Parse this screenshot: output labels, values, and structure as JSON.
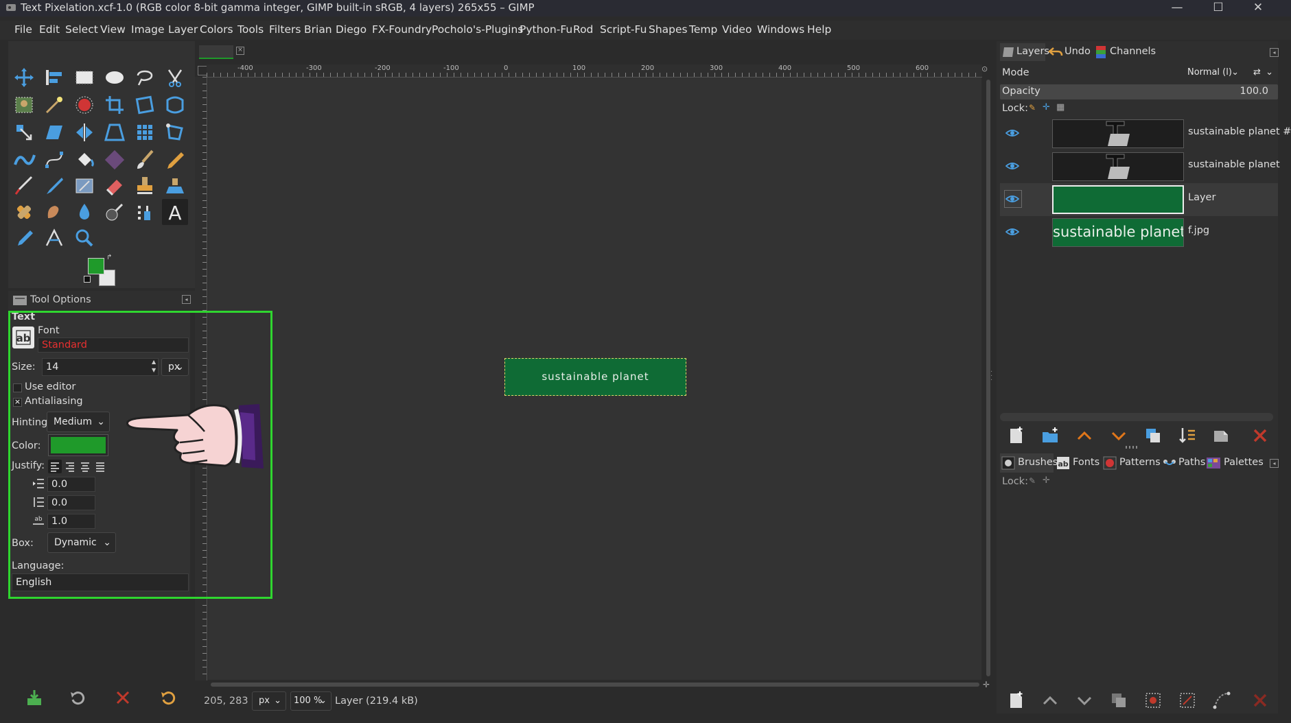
{
  "window": {
    "title": "Text Pixelation.xcf-1.0 (RGB color 8-bit gamma integer, GIMP built-in sRGB, 4 layers) 265x55 – GIMP",
    "minimize": "—",
    "maximize": "☐",
    "close": "✕"
  },
  "menu": [
    "File",
    "Edit",
    "Select",
    "View",
    "Image",
    "Layer",
    "Colors",
    "Tools",
    "Filters",
    "Brian",
    "Diego",
    "FX-Foundry",
    "Pocholo's-Plugins",
    "Python-Fu",
    "Rod",
    "Script-Fu",
    "Shapes",
    "Temp",
    "Video",
    "Windows",
    "Help"
  ],
  "toolbox": {
    "fg_color": "#1f9a2a",
    "bg_color": "#e8e8e8"
  },
  "tool_options": {
    "tab_label": "Tool Options",
    "tool_name": "Text",
    "font_label": "Font",
    "font_value": "Standard",
    "size_label": "Size:",
    "size_value": "14",
    "size_unit": "px",
    "use_editor_label": "Use editor",
    "antialiasing_label": "Antialiasing",
    "antialiasing_checked": "×",
    "hinting_label": "Hinting:",
    "hinting_value": "Medium",
    "color_label": "Color:",
    "color_value": "#1f9a2a",
    "justify_label": "Justify:",
    "indent_value": "0.0",
    "line_spacing_value": "0.0",
    "letter_spacing_value": "1.0",
    "box_label": "Box:",
    "box_value": "Dynamic",
    "language_label": "Language:",
    "language_value": "English"
  },
  "canvas": {
    "image_text": "sustainable planet",
    "image_color": "#0f6b35",
    "ruler_h_labels": [
      "-400",
      "-300",
      "-200",
      "-100",
      "0",
      "100",
      "200",
      "300",
      "400",
      "500",
      "600"
    ],
    "ruler_v_labels": [
      "400",
      "300",
      "200",
      "100",
      "0",
      "100",
      "200",
      "300"
    ]
  },
  "status": {
    "coords": "205, 283",
    "unit": "px",
    "zoom": "100 %",
    "layer_info": "Layer (219.4 kB)"
  },
  "layers_panel": {
    "tabs": [
      "Layers",
      "Undo",
      "Channels"
    ],
    "mode_label": "Mode",
    "mode_value": "Normal (l)",
    "opacity_label": "Opacity",
    "opacity_value": "100.0",
    "lock_label": "Lock:",
    "layers": [
      {
        "name": "sustainable planet #1"
      },
      {
        "name": "sustainable planet"
      },
      {
        "name": "Layer"
      },
      {
        "name": "f.jpg",
        "thumb_text": "sustainable planet"
      }
    ]
  },
  "bottom_panel": {
    "tabs": [
      "Brushes",
      "Fonts",
      "Patterns",
      "Paths",
      "Palettes"
    ],
    "lock_label": "Lock:"
  }
}
